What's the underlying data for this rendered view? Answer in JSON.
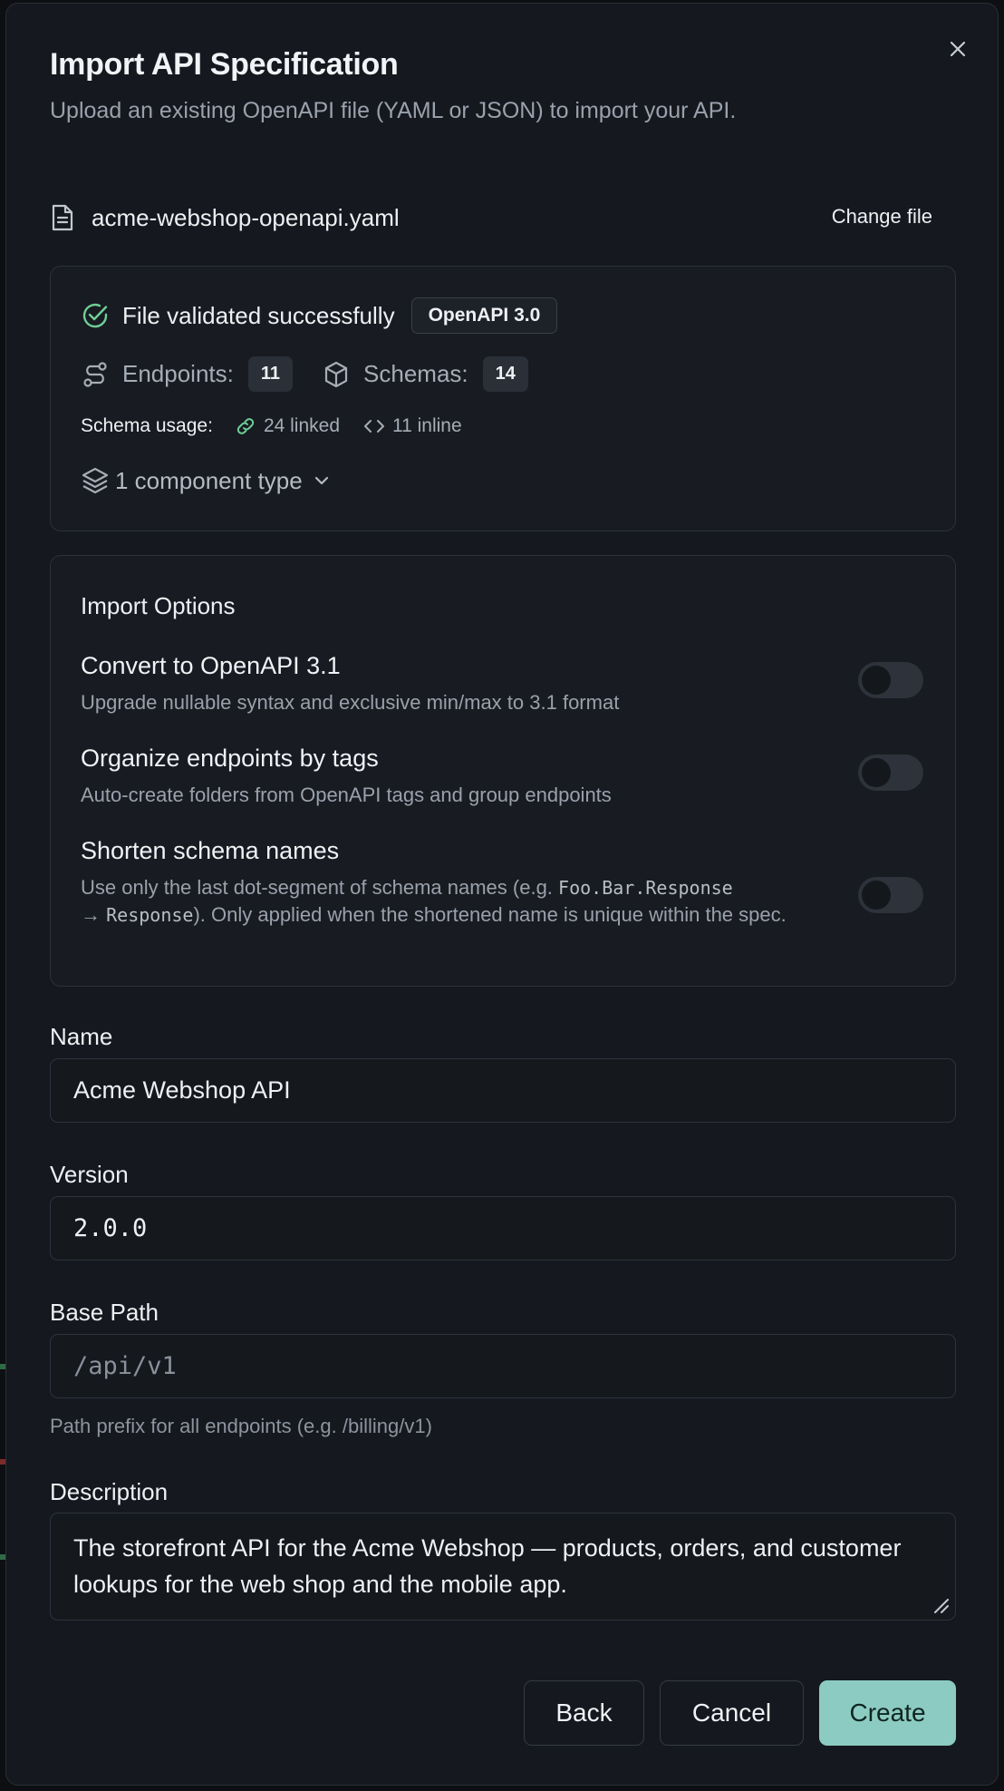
{
  "dialog": {
    "title": "Import API Specification",
    "subtitle": "Upload an existing OpenAPI file (YAML or JSON) to import your API."
  },
  "file": {
    "name": "acme-webshop-openapi.yaml",
    "change_label": "Change file"
  },
  "validation": {
    "status": "File validated successfully",
    "spec_version": "OpenAPI 3.0",
    "endpoints_label": "Endpoints:",
    "endpoints_count": "11",
    "schemas_label": "Schemas:",
    "schemas_count": "14",
    "usage_label": "Schema usage:",
    "linked": "24 linked",
    "inline": "11 inline",
    "component_types": "1 component type",
    "success_color": "#6fcf97"
  },
  "options": {
    "title": "Import Options",
    "items": [
      {
        "label": "Convert to OpenAPI 3.1",
        "desc": "Upgrade nullable syntax and exclusive min/max to 3.1 format",
        "enabled": false
      },
      {
        "label": "Organize endpoints by tags",
        "desc": "Auto-create folders from OpenAPI tags and group endpoints",
        "enabled": false
      },
      {
        "label": "Shorten schema names",
        "desc_pre": "Use only the last dot-segment of schema names (e.g. ",
        "desc_code1": "Foo.Bar.Response",
        "desc_arrow": "\n→ ",
        "desc_code2": "Response",
        "desc_post": "). Only applied when the shortened name is unique within the spec.",
        "enabled": false
      }
    ]
  },
  "form": {
    "name_label": "Name",
    "name_value": "Acme Webshop API",
    "version_label": "Version",
    "version_value": "2.0.0",
    "base_path_label": "Base Path",
    "base_path_placeholder": "/api/v1",
    "base_path_hint": "Path prefix for all endpoints (e.g. /billing/v1)",
    "description_label": "Description",
    "description_line1": "The storefront API for the Acme Webshop — products, orders, and customer",
    "description_line2": "lookups for the web shop and the mobile app."
  },
  "actions": {
    "back": "Back",
    "cancel": "Cancel",
    "create": "Create",
    "primary_color": "#8ccbc1"
  }
}
